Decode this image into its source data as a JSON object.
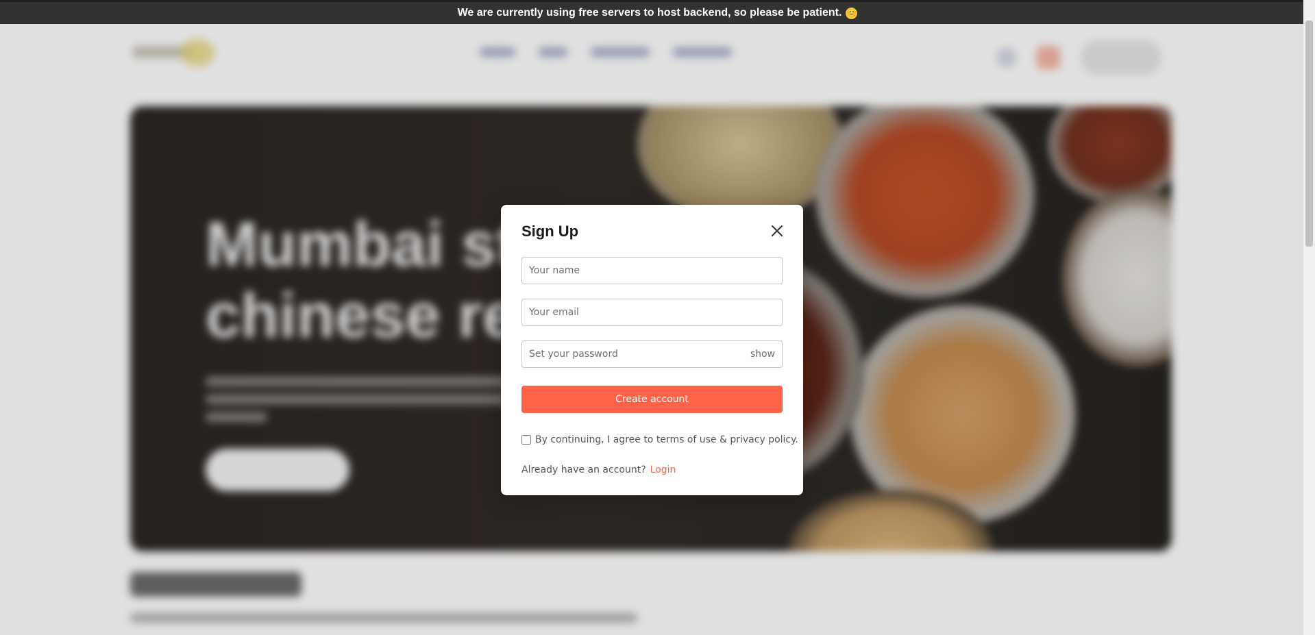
{
  "banner": {
    "text": "We are currently using free servers to host backend, so please be patient.",
    "emoji": "😊"
  },
  "hero": {
    "title_line1": "Mumbai sty",
    "title_line2": "chinese res"
  },
  "modal": {
    "title": "Sign Up",
    "name_placeholder": "Your name",
    "email_placeholder": "Your email",
    "password_placeholder": "Set your password",
    "show_label": "show",
    "create_button": "Create account",
    "terms_text": "By continuing, I agree to terms of use & privacy policy.",
    "already_text": "Already have an account?",
    "login_label": "Login"
  },
  "colors": {
    "accent": "#ff6347",
    "banner_bg": "#323232"
  },
  "icons": {
    "close": "close-icon"
  }
}
